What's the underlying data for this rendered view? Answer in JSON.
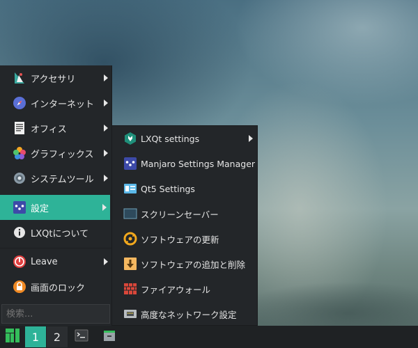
{
  "main_menu": {
    "items": [
      {
        "label": "アクセサリ",
        "icon": "accessories-icon",
        "submenu": true
      },
      {
        "label": "インターネット",
        "icon": "compass-icon",
        "submenu": true
      },
      {
        "label": "オフィス",
        "icon": "document-icon",
        "submenu": true
      },
      {
        "label": "グラフィックス",
        "icon": "graphics-icon",
        "submenu": true
      },
      {
        "label": "システムツール",
        "icon": "gear-icon",
        "submenu": true
      },
      {
        "label": "設定",
        "icon": "settings-icon",
        "submenu": true,
        "active": true
      },
      {
        "label": "LXQtについて",
        "icon": "info-icon",
        "submenu": false
      },
      {
        "label": "Leave",
        "icon": "power-icon",
        "submenu": true
      },
      {
        "label": "画面のロック",
        "icon": "lock-icon",
        "submenu": false
      }
    ],
    "search_placeholder": "検索..."
  },
  "settings_submenu": {
    "items": [
      {
        "label": "LXQt settings",
        "icon": "lxqt-settings-icon",
        "submenu": true
      },
      {
        "label": "Manjaro Settings Manager",
        "icon": "manjaro-settings-icon"
      },
      {
        "label": "Qt5 Settings",
        "icon": "qt5-settings-icon"
      },
      {
        "label": "スクリーンセーバー",
        "icon": "screensaver-icon"
      },
      {
        "label": "ソフトウェアの更新",
        "icon": "software-update-icon"
      },
      {
        "label": "ソフトウェアの追加と削除",
        "icon": "add-remove-software-icon"
      },
      {
        "label": "ファイアウォール",
        "icon": "firewall-icon"
      },
      {
        "label": "高度なネットワーク設定",
        "icon": "network-settings-icon"
      }
    ]
  },
  "panel": {
    "desktops": [
      "1",
      "2"
    ],
    "active_desktop": "1",
    "launchers": [
      "manjaro-logo-icon",
      "terminal-icon",
      "file-manager-icon"
    ]
  },
  "colors": {
    "accent": "#2eb398",
    "menu_bg": "#232629",
    "panel_bg": "#1f2224"
  }
}
